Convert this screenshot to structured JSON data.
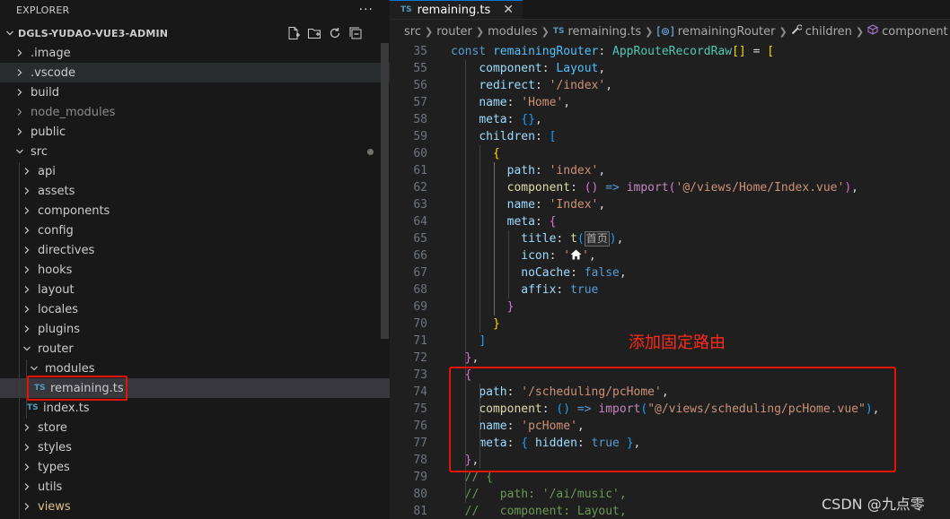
{
  "sidebar": {
    "header": "EXPLORER",
    "more": "···",
    "project": "DGLS-YUDAO-VUE3-ADMIN",
    "items": [
      {
        "label": ".image",
        "kind": "folder",
        "depth": 0,
        "open": false
      },
      {
        "label": ".vscode",
        "kind": "folder",
        "depth": 0,
        "open": false
      },
      {
        "label": "build",
        "kind": "folder",
        "depth": 0,
        "open": false
      },
      {
        "label": "node_modules",
        "kind": "folder",
        "depth": 0,
        "open": false
      },
      {
        "label": "public",
        "kind": "folder",
        "depth": 0,
        "open": false
      },
      {
        "label": "src",
        "kind": "folder",
        "depth": 0,
        "open": true
      },
      {
        "label": "api",
        "kind": "folder",
        "depth": 1,
        "open": false
      },
      {
        "label": "assets",
        "kind": "folder",
        "depth": 1,
        "open": false
      },
      {
        "label": "components",
        "kind": "folder",
        "depth": 1,
        "open": false
      },
      {
        "label": "config",
        "kind": "folder",
        "depth": 1,
        "open": false
      },
      {
        "label": "directives",
        "kind": "folder",
        "depth": 1,
        "open": false
      },
      {
        "label": "hooks",
        "kind": "folder",
        "depth": 1,
        "open": false
      },
      {
        "label": "layout",
        "kind": "folder",
        "depth": 1,
        "open": false
      },
      {
        "label": "locales",
        "kind": "folder",
        "depth": 1,
        "open": false
      },
      {
        "label": "plugins",
        "kind": "folder",
        "depth": 1,
        "open": false
      },
      {
        "label": "router",
        "kind": "folder",
        "depth": 1,
        "open": true
      },
      {
        "label": "modules",
        "kind": "folder",
        "depth": 2,
        "open": true
      },
      {
        "label": "remaining.ts",
        "kind": "ts-file",
        "depth": 3
      },
      {
        "label": "index.ts",
        "kind": "ts-file",
        "depth": 2
      },
      {
        "label": "store",
        "kind": "folder",
        "depth": 1,
        "open": false
      },
      {
        "label": "styles",
        "kind": "folder",
        "depth": 1,
        "open": false
      },
      {
        "label": "types",
        "kind": "folder",
        "depth": 1,
        "open": false
      },
      {
        "label": "utils",
        "kind": "folder",
        "depth": 1,
        "open": false
      },
      {
        "label": "views",
        "kind": "folder",
        "depth": 1,
        "open": false
      }
    ]
  },
  "editor": {
    "tab": {
      "badge": "TS",
      "label": "remaining.ts",
      "close": "✕"
    },
    "breadcrumb": {
      "src": "src",
      "router": "router",
      "modules": "modules",
      "file_badge": "TS",
      "file": "remaining.ts",
      "symbol": "remainingRouter",
      "children": "children",
      "component": "component"
    },
    "gutter_top": "35",
    "lines": [
      {
        "n": "55"
      },
      {
        "n": "56"
      },
      {
        "n": "57"
      },
      {
        "n": "58"
      },
      {
        "n": "59"
      },
      {
        "n": "60"
      },
      {
        "n": "61"
      },
      {
        "n": "62"
      },
      {
        "n": "63"
      },
      {
        "n": "64"
      },
      {
        "n": "65"
      },
      {
        "n": "66"
      },
      {
        "n": "67"
      },
      {
        "n": "68"
      },
      {
        "n": "69"
      },
      {
        "n": "70"
      },
      {
        "n": "71"
      },
      {
        "n": "72"
      },
      {
        "n": "73"
      },
      {
        "n": "74"
      },
      {
        "n": "75"
      },
      {
        "n": "76"
      },
      {
        "n": "77"
      },
      {
        "n": "78"
      },
      {
        "n": "79"
      },
      {
        "n": "80"
      },
      {
        "n": "81"
      }
    ],
    "inlay_hint": "首页",
    "annotation": "添加固定路由",
    "watermark": "CSDN @九点零"
  }
}
